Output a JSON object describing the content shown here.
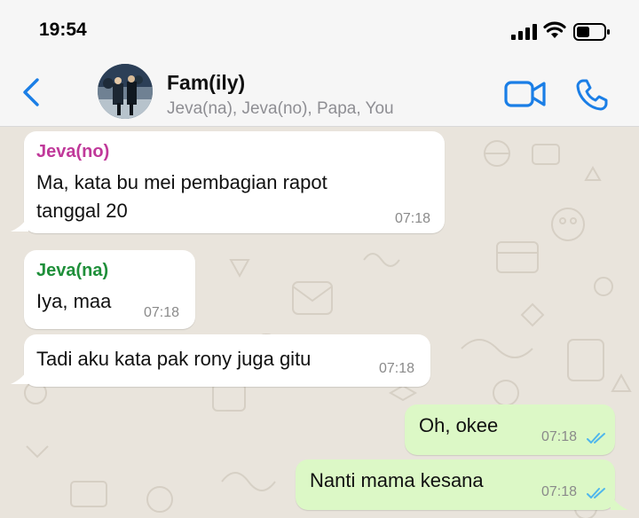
{
  "status_bar": {
    "time": "19:54",
    "icons": [
      "cellular-signal-icon",
      "wifi-icon",
      "battery-icon"
    ]
  },
  "header": {
    "back_icon": "chevron-left-icon",
    "group_name": "Fam(ily)",
    "members": "Jeva(na), Jeva(no), Papa, You",
    "video_icon": "video-camera-icon",
    "call_icon": "phone-icon",
    "accent_color": "#1a7ee6"
  },
  "messages": [
    {
      "direction": "in",
      "sender": "Jeva(no)",
      "sender_color": "#c0399a",
      "text_line1": "Ma, kata bu mei pembagian rapot",
      "text_line2": "tanggal 20",
      "time": "07:18"
    },
    {
      "direction": "in",
      "sender": "Jeva(na)",
      "sender_color": "#1f8f3a",
      "text": "Iya, maa",
      "time": "07:18"
    },
    {
      "direction": "in",
      "text": "Tadi aku kata pak rony juga gitu",
      "time": "07:18"
    },
    {
      "direction": "out",
      "text": "Oh, okee",
      "time": "07:18",
      "status": "read"
    },
    {
      "direction": "out",
      "text": "Nanti mama kesana",
      "time": "07:18",
      "status": "read"
    }
  ],
  "colors": {
    "incoming_bubble": "#ffffff",
    "outgoing_bubble": "#dcf8c6",
    "read_ticks": "#4fb6ec",
    "chat_background": "#e9e4dc"
  }
}
